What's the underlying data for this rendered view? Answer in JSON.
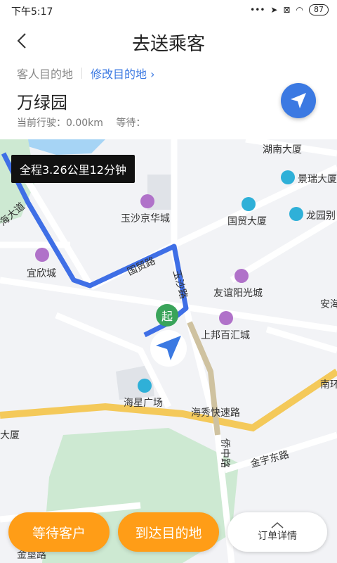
{
  "status": {
    "time": "下午5:17",
    "battery": "87"
  },
  "header": {
    "title": "去送乘客"
  },
  "destination": {
    "label": "客人目的地",
    "modify": "修改目的地 ›"
  },
  "place": {
    "name": "万绿园"
  },
  "trip": {
    "distance": "当前行驶：0.00km",
    "wait": "等待："
  },
  "map": {
    "summary": "全程3.26公里12分钟",
    "start_marker": "起",
    "pois": [
      "湖南大厦",
      "景瑞大厦",
      "国贸大厦",
      "龙园别",
      "玉沙京华城",
      "宜欣城",
      "友谊阳光城",
      "安海",
      "上邦百汇城",
      "海星广场",
      "南环",
      "大厦"
    ],
    "roads": [
      "国贸路",
      "玉沙路",
      "海秀快速路",
      "侨中路",
      "金宇东路",
      "海大道",
      "金垦路"
    ]
  },
  "bottom": {
    "wait_btn": "等待客户",
    "arrive_btn": "到达目的地",
    "detail_btn": "订单详情"
  },
  "colors": {
    "accent": "#3b79e2",
    "orange": "#ff9d17",
    "route": "#3f6fe6"
  }
}
